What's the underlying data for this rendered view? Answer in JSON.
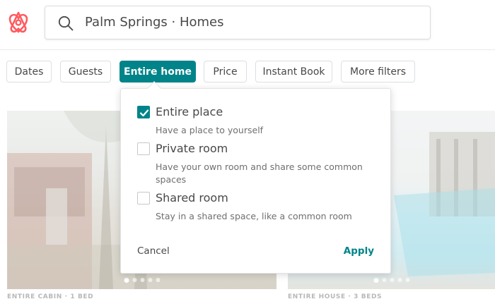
{
  "colors": {
    "accent": "#008489",
    "brand": "#FF5A5F"
  },
  "header": {
    "logo_icon": "airbnb-logo",
    "search_icon": "search-icon",
    "search_value": "Palm Springs · Homes"
  },
  "filters": [
    {
      "label": "Dates",
      "active": false
    },
    {
      "label": "Guests",
      "active": false
    },
    {
      "label": "Entire home",
      "active": true
    },
    {
      "label": "Price",
      "active": false
    },
    {
      "label": "Instant Book",
      "active": false
    },
    {
      "label": "More filters",
      "active": false
    }
  ],
  "room_type_menu": {
    "options": [
      {
        "label": "Entire place",
        "description": "Have a place to yourself",
        "checked": true
      },
      {
        "label": "Private room",
        "description": "Have your own room and share some common spaces",
        "checked": false
      },
      {
        "label": "Shared room",
        "description": "Stay in a shared space, like a common room",
        "checked": false
      }
    ],
    "cancel_label": "Cancel",
    "apply_label": "Apply"
  },
  "listings": [
    {
      "caption": "ENTIRE CABIN · 1 BED"
    },
    {
      "caption": "ENTIRE HOUSE · 3 BEDS"
    }
  ]
}
